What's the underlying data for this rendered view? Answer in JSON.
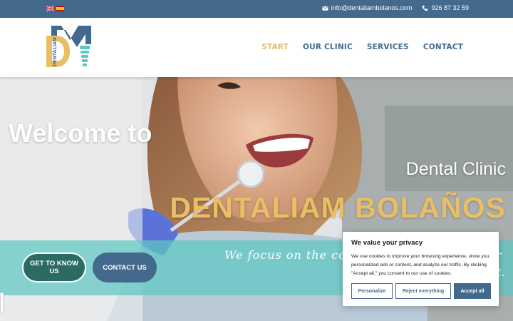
{
  "topbar": {
    "languages": [
      "English",
      "Español"
    ],
    "email": "info@dentaliambolanos.com",
    "phone": "926 87 32 59"
  },
  "logo": {
    "text": "DENTALIAM",
    "icon": "tooth-implant-logo"
  },
  "nav": {
    "items": [
      {
        "label": "START",
        "active": true
      },
      {
        "label": "OUR CLINIC",
        "active": false
      },
      {
        "label": "SERVICES",
        "active": false
      },
      {
        "label": "CONTACT",
        "active": false
      }
    ]
  },
  "hero": {
    "welcome": "Welcome to",
    "subtitle": "Dental Clinic",
    "brand": "DENTALIAM BOLAÑOS",
    "tagline": "We focus on the com",
    "tagline_end": "r",
    "tagline_end2": "t.",
    "buttons": {
      "know": "GET TO KNOW US",
      "contact": "CONTACT US"
    }
  },
  "cookie": {
    "title": "We value your privacy",
    "text": "We use cookies to improve your browsing experience, show you personalized ads or content, and analyze our traffic. By clicking \"Accept all,\" you consent to our use of cookies.",
    "personalize": "Personalize",
    "reject": "Reject everything",
    "accept": "Accept all"
  },
  "colors": {
    "primary": "#43698d",
    "accent": "#e9be65",
    "teal": "#5dc8c2",
    "dark_teal": "#2c6a64"
  }
}
